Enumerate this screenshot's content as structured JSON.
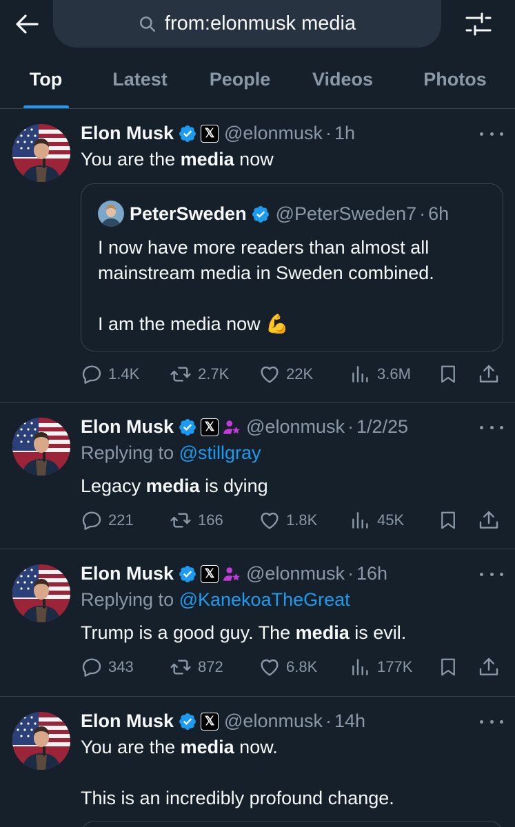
{
  "search": {
    "query": "from:elonmusk media"
  },
  "tabs": [
    "Top",
    "Latest",
    "People",
    "Videos",
    "Photos"
  ],
  "posts": [
    {
      "name": "Elon Musk",
      "handle": "@elonmusk",
      "time": "1h",
      "text_pre": "You are the ",
      "text_bold": "media",
      "text_post": " now",
      "quote": {
        "name": "PeterSweden",
        "handle": "@PeterSweden7",
        "time": "6h",
        "text": "I now have more readers than almost all mainstream media in Sweden combined.\n\nI am the media now 💪"
      },
      "stats": {
        "replies": "1.4K",
        "reposts": "2.7K",
        "likes": "22K",
        "views": "3.6M"
      }
    },
    {
      "name": "Elon Musk",
      "handle": "@elonmusk",
      "time": "1/2/25",
      "reply_prefix": "Replying to ",
      "reply_to": "@stillgray",
      "text_pre": "Legacy ",
      "text_bold": "media",
      "text_post": " is dying",
      "stats": {
        "replies": "221",
        "reposts": "166",
        "likes": "1.8K",
        "views": "45K"
      }
    },
    {
      "name": "Elon Musk",
      "handle": "@elonmusk",
      "time": "16h",
      "reply_prefix": "Replying to ",
      "reply_to": "@KanekoaTheGreat",
      "text_pre": "Trump is a good guy. The ",
      "text_bold": "media",
      "text_post": " is evil.",
      "stats": {
        "replies": "343",
        "reposts": "872",
        "likes": "6.8K",
        "views": "177K"
      }
    },
    {
      "name": "Elon Musk",
      "handle": "@elonmusk",
      "time": "14h",
      "text_pre": "You are the ",
      "text_bold": "media",
      "text_post": " now.\n\nThis is an incredibly profound change."
    }
  ],
  "colors": {
    "background": "#15202b",
    "accent": "#1d9bf0",
    "muted": "#8b98a5",
    "text": "#f7f9f9",
    "border": "#38444d",
    "affiliate": "#c13bd8"
  },
  "icons": [
    "back-arrow-icon",
    "search-icon",
    "filter-sliders-icon",
    "verified-icon",
    "x-badge-icon",
    "affiliate-icon",
    "more-icon",
    "reply-icon",
    "repost-icon",
    "like-icon",
    "views-icon",
    "bookmark-icon",
    "share-icon"
  ]
}
